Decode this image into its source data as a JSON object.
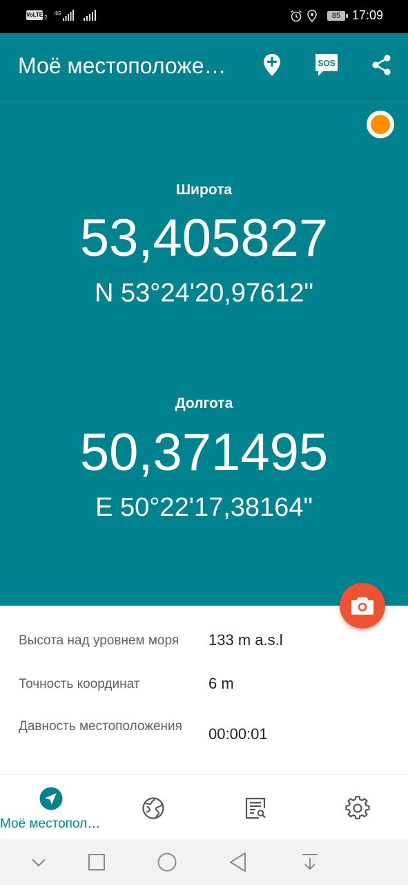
{
  "status_bar": {
    "volte": "VoLTE",
    "sim_sub": "2",
    "network": "4G",
    "battery": "85",
    "time": "17:09",
    "icons": [
      "volte-icon",
      "signal-icon",
      "alarm-icon",
      "location-icon",
      "battery-icon"
    ]
  },
  "app_bar": {
    "title": "Моё местоположение",
    "actions": [
      "add-place-icon",
      "sos-icon",
      "share-icon"
    ],
    "sos_label": "SOS"
  },
  "latitude": {
    "label": "Широта",
    "decimal": "53,405827",
    "dms": "N 53°24'20,97612\""
  },
  "longitude": {
    "label": "Долгота",
    "decimal": "50,371495",
    "dms": "E 50°22'17,38164\""
  },
  "gps_status_color": "#ff8f00",
  "details": [
    {
      "label": "Высота над уровнем моря",
      "value": "133 m a.s.l"
    },
    {
      "label": "Точность координат",
      "value": "6 m"
    },
    {
      "label": "Давность местоположения",
      "value": "00:00:01"
    }
  ],
  "bottom_nav": {
    "items": [
      {
        "icon": "navigation-arrow-icon",
        "label": "Моё местоположение",
        "active": true
      },
      {
        "icon": "globe-icon",
        "label": "",
        "active": false
      },
      {
        "icon": "list-search-icon",
        "label": "",
        "active": false
      },
      {
        "icon": "gear-icon",
        "label": "",
        "active": false
      }
    ]
  },
  "system_nav": [
    "chevron-down-icon",
    "recents-square-icon",
    "home-circle-icon",
    "back-triangle-icon",
    "notification-pull-icon"
  ],
  "colors": {
    "primary": "#00838f",
    "fab": "#ef5233",
    "status_dot": "#ff8f00"
  }
}
